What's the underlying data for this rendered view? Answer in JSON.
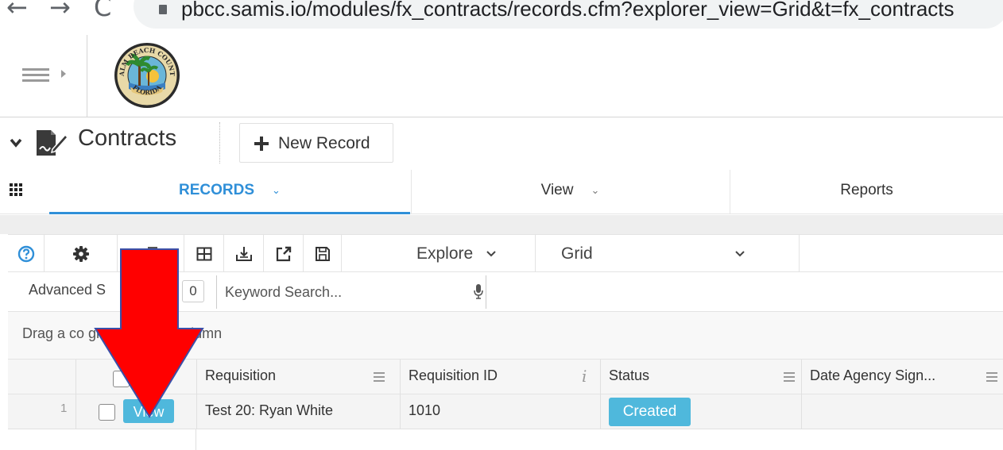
{
  "browser": {
    "back_glyph": "←",
    "forward_glyph": "→",
    "reload_glyph": "C",
    "url": "pbcc.samis.io/modules/fx_contracts/records.cfm?explorer_view=Grid&t=fx_contracts"
  },
  "header": {
    "logo_icon": "palm-beach-county-seal",
    "logo_text_top": "PALM BEACH COUNTY",
    "logo_text_bottom": "FLORIDA"
  },
  "module": {
    "title": "Contracts",
    "new_record_label": "New Record"
  },
  "tabs": [
    {
      "label": "RECORDS",
      "active": true
    },
    {
      "label": "View",
      "active": false
    },
    {
      "label": "Reports",
      "active": false
    }
  ],
  "toolbar": {
    "explore_label": "Explore",
    "grid_label": "Grid",
    "icons": [
      "help-icon",
      "gear-icon",
      "copy-icon",
      "columns-icon",
      "export-icon",
      "external-link-icon",
      "save-icon"
    ]
  },
  "search": {
    "advanced_label": "Advanced S",
    "count": "0",
    "keyword_placeholder": "Keyword Search..."
  },
  "group_hint": "Drag a co                group by that column",
  "grid": {
    "columns": [
      "Requisition",
      "Requisition ID",
      "Status",
      "Date Agency Sign..."
    ],
    "rows": [
      {
        "num": "1",
        "view_label": "View",
        "requisition": "Test 20: Ryan White",
        "requisition_id": "1010",
        "status": "Created"
      }
    ]
  },
  "colors": {
    "accent_blue": "#2f8fd8",
    "badge_blue": "#4fb8dc",
    "annotation_red": "#ff0000"
  }
}
